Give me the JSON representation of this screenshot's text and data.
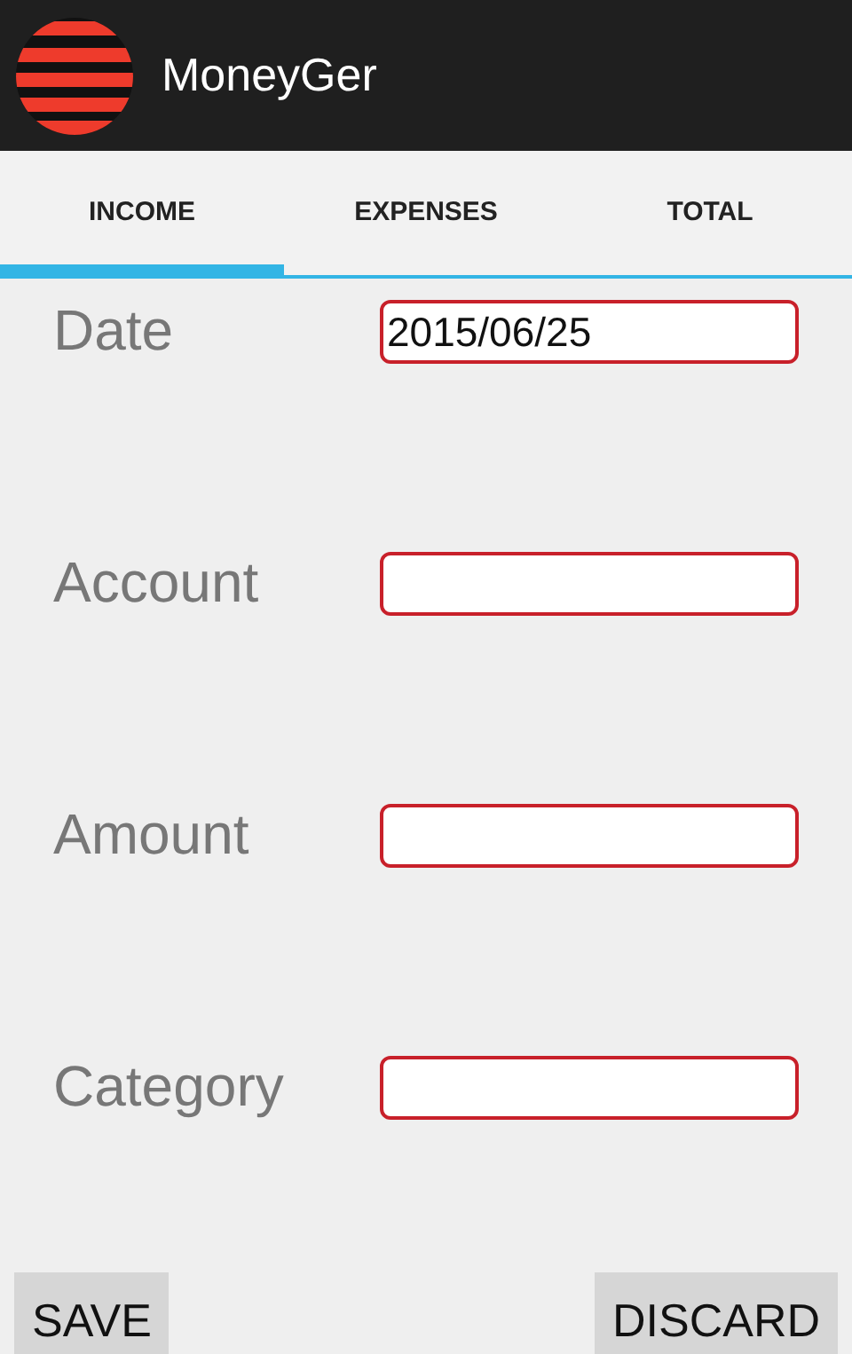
{
  "app_bar": {
    "title": "MoneyGer"
  },
  "tabs": [
    {
      "label": "INCOME",
      "selected": true
    },
    {
      "label": "EXPENSES",
      "selected": false
    },
    {
      "label": "TOTAL",
      "selected": false
    }
  ],
  "fields": [
    {
      "label": "Date",
      "value": "2015/06/25"
    },
    {
      "label": "Account"
    },
    {
      "label": "Amount"
    },
    {
      "label": "Category"
    }
  ],
  "buttons": [
    {
      "label": "SAVE"
    },
    {
      "label": "DISCARD"
    }
  ]
}
